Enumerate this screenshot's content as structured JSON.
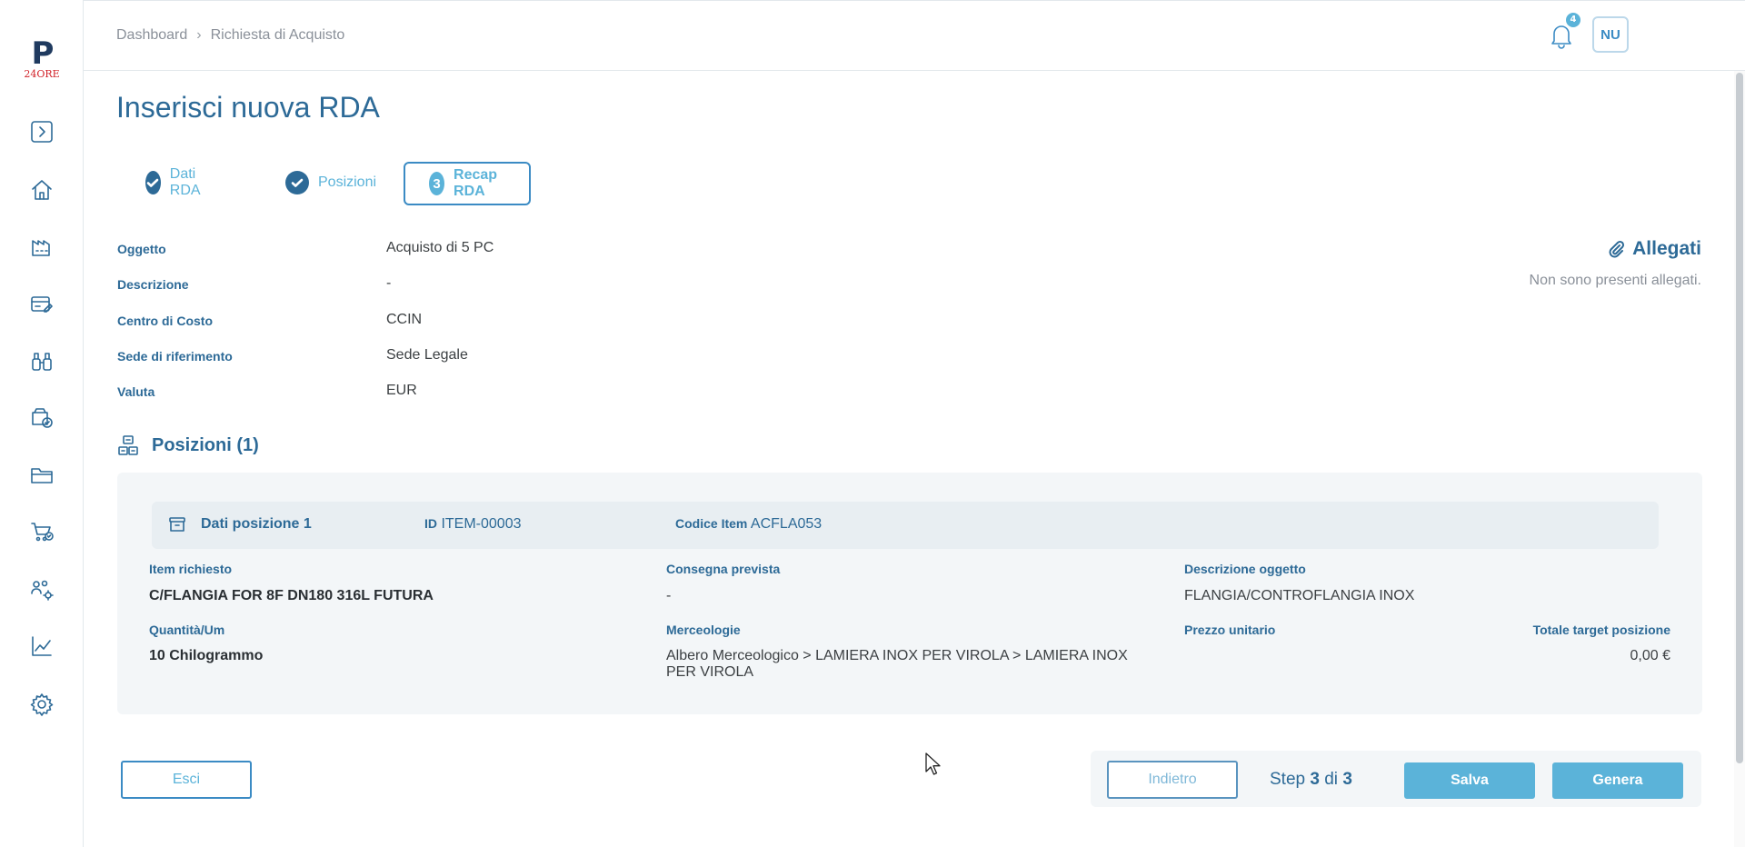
{
  "sidebar": {
    "logo": {
      "letter": "P",
      "brand": "24ORE"
    },
    "items": [
      {
        "icon": "expand-icon"
      },
      {
        "icon": "home-icon"
      },
      {
        "icon": "factory-icon"
      },
      {
        "icon": "card-edit-icon"
      },
      {
        "icon": "binoculars-icon"
      },
      {
        "icon": "box-check-icon"
      },
      {
        "icon": "folder-icon"
      },
      {
        "icon": "cart-check-icon"
      },
      {
        "icon": "users-gear-icon"
      },
      {
        "icon": "chart-line-icon"
      },
      {
        "icon": "settings-icon"
      }
    ]
  },
  "header": {
    "breadcrumb": [
      "Dashboard",
      "Richiesta di Acquisto"
    ],
    "notifications_count": "4",
    "user_initials": "NU"
  },
  "page": {
    "title": "Inserisci nuova RDA",
    "steps": [
      {
        "label": "Dati RDA",
        "state": "done"
      },
      {
        "label": "Posizioni",
        "state": "done"
      },
      {
        "label": "Recap RDA",
        "number": "3",
        "state": "active"
      }
    ],
    "fields": [
      {
        "label": "Oggetto",
        "value": "Acquisto di 5 PC"
      },
      {
        "label": "Descrizione",
        "value": "-"
      },
      {
        "label": "Centro di Costo",
        "value": "CCIN"
      },
      {
        "label": "Sede di riferimento",
        "value": "Sede Legale"
      },
      {
        "label": "Valuta",
        "value": "EUR"
      }
    ],
    "attachments": {
      "title": "Allegati",
      "empty_text": "Non sono presenti allegati."
    },
    "positions": {
      "title": "Posizioni (1)",
      "items": [
        {
          "title": "Dati posizione 1",
          "id_label": "ID",
          "id_value": "ITEM-00003",
          "code_label": "Codice Item",
          "code_value": "ACFLA053",
          "item_label": "Item richiesto",
          "item_value": "C/FLANGIA FOR 8F DN180 316L FUTURA",
          "delivery_label": "Consegna prevista",
          "delivery_value": "-",
          "desc_label": "Descrizione oggetto",
          "desc_value": "FLANGIA/CONTROFLANGIA INOX",
          "qty_label": "Quantità/Um",
          "qty_value": "10 Chilogrammo",
          "category_label": "Merceologie",
          "category_value_line1": "Albero Merceologico > LAMIERA INOX PER VIROLA > LAMIERA INOX",
          "category_value_line2": "PER VIROLA",
          "unit_price_label": "Prezzo unitario",
          "total_label": "Totale target posizione",
          "total_value": "0,00 €"
        }
      ]
    }
  },
  "footer": {
    "exit_label": "Esci",
    "back_label": "Indietro",
    "step_prefix": "Step",
    "step_current": "3",
    "step_sep": "di",
    "step_total": "3",
    "save_label": "Salva",
    "generate_label": "Genera"
  },
  "colors": {
    "primary": "#2d6a97",
    "accent": "#5bb3d9",
    "brand_red": "#d2232a"
  }
}
